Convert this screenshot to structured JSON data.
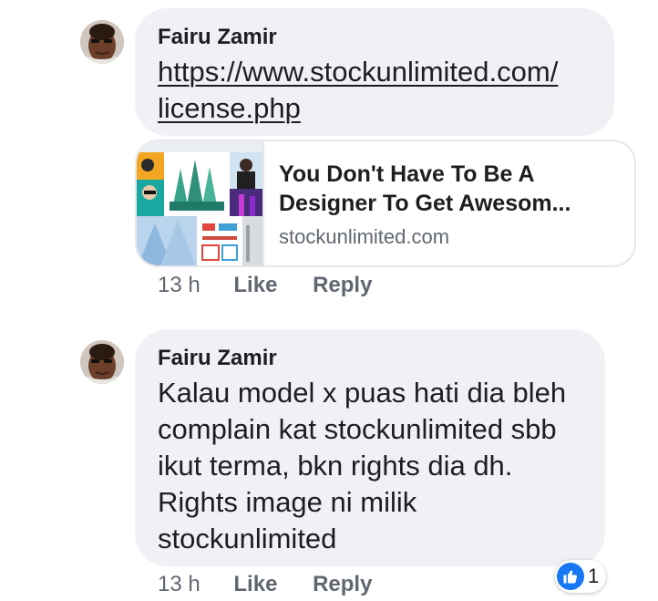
{
  "comments": [
    {
      "author": "Fairu Zamir",
      "link_line1": "https://www.stockunlimited.com/",
      "link_line2": "license.php",
      "preview": {
        "title_line1": "You Don't Have To Be A",
        "title_line2": "Designer To Get Awesom...",
        "domain": "stockunlimited.com"
      },
      "time": "13 h",
      "like_label": "Like",
      "reply_label": "Reply"
    },
    {
      "author": "Fairu Zamir",
      "text_lines": [
        "Kalau model x puas hati dia bleh",
        "complain kat stockunlimited sbb",
        "ikut terma, bkn rights dia dh.",
        "Rights image ni milik",
        "stockunlimited"
      ],
      "time": "13 h",
      "like_label": "Like",
      "reply_label": "Reply",
      "reaction": {
        "icon": "thumbs-up-icon",
        "count": "1",
        "color": "#1877f2"
      }
    }
  ]
}
